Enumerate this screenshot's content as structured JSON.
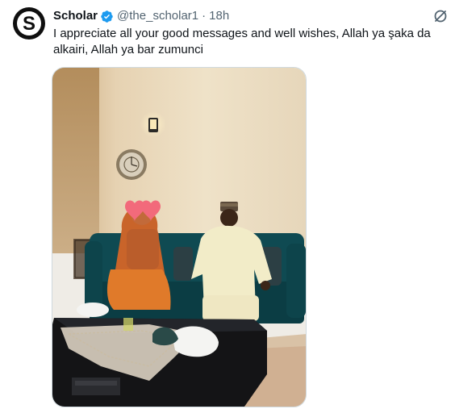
{
  "tweet": {
    "author": {
      "display_name": "Scholar",
      "verified": true,
      "handle": "@the_scholar1",
      "avatar_letter": "S"
    },
    "separator": "·",
    "time": "18h",
    "text": "I appreciate all your good messages and well wishes, Allah ya şaka da alkairi, Allah ya bar zumunci",
    "icons": {
      "verified": "verified-badge-icon",
      "grok": "grok-icon"
    },
    "media": {
      "kind": "photo",
      "emoji_overlay": "heart-eyes-emoji"
    }
  },
  "colors": {
    "text_primary": "#0f1419",
    "text_secondary": "#536471",
    "verified_blue": "#1d9bf0",
    "border": "#cfd9de"
  }
}
